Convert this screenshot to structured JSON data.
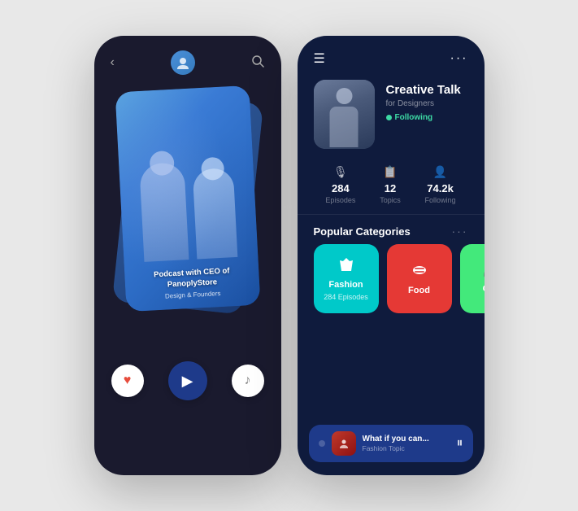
{
  "left_phone": {
    "header": {
      "back_label": "‹",
      "search_label": "🔍"
    },
    "card": {
      "title": "Podcast with CEO of PanoplyStore",
      "subtitle": "Design & Founders"
    },
    "controls": {
      "heart_icon": "♥",
      "play_icon": "▶",
      "music_icon": "♪"
    }
  },
  "right_phone": {
    "header": {
      "hamburger": "☰",
      "more": "···"
    },
    "profile": {
      "name": "Creative Talk",
      "handle": "for Designers",
      "following_label": "Following"
    },
    "stats": [
      {
        "icon": "🎙",
        "value": "284",
        "label": "Episodes"
      },
      {
        "icon": "📋",
        "value": "12",
        "label": "Topics"
      },
      {
        "icon": "👤",
        "value": "74.2k",
        "label": "Following"
      }
    ],
    "categories_title": "Popular Categories",
    "categories_more": "···",
    "categories": [
      {
        "icon": "👗",
        "name": "Fashion",
        "episodes": "284 Episodes",
        "color_class": "cat-fashion"
      },
      {
        "icon": "🍔",
        "name": "Food",
        "episodes": "",
        "color_class": "cat-food"
      },
      {
        "icon": "🎮",
        "name": "Ga...",
        "episodes": "",
        "color_class": "cat-gaming"
      }
    ],
    "now_playing": {
      "title": "What if you can...",
      "subtitle": "Fashion Topic",
      "play_icon": "⏸"
    }
  }
}
